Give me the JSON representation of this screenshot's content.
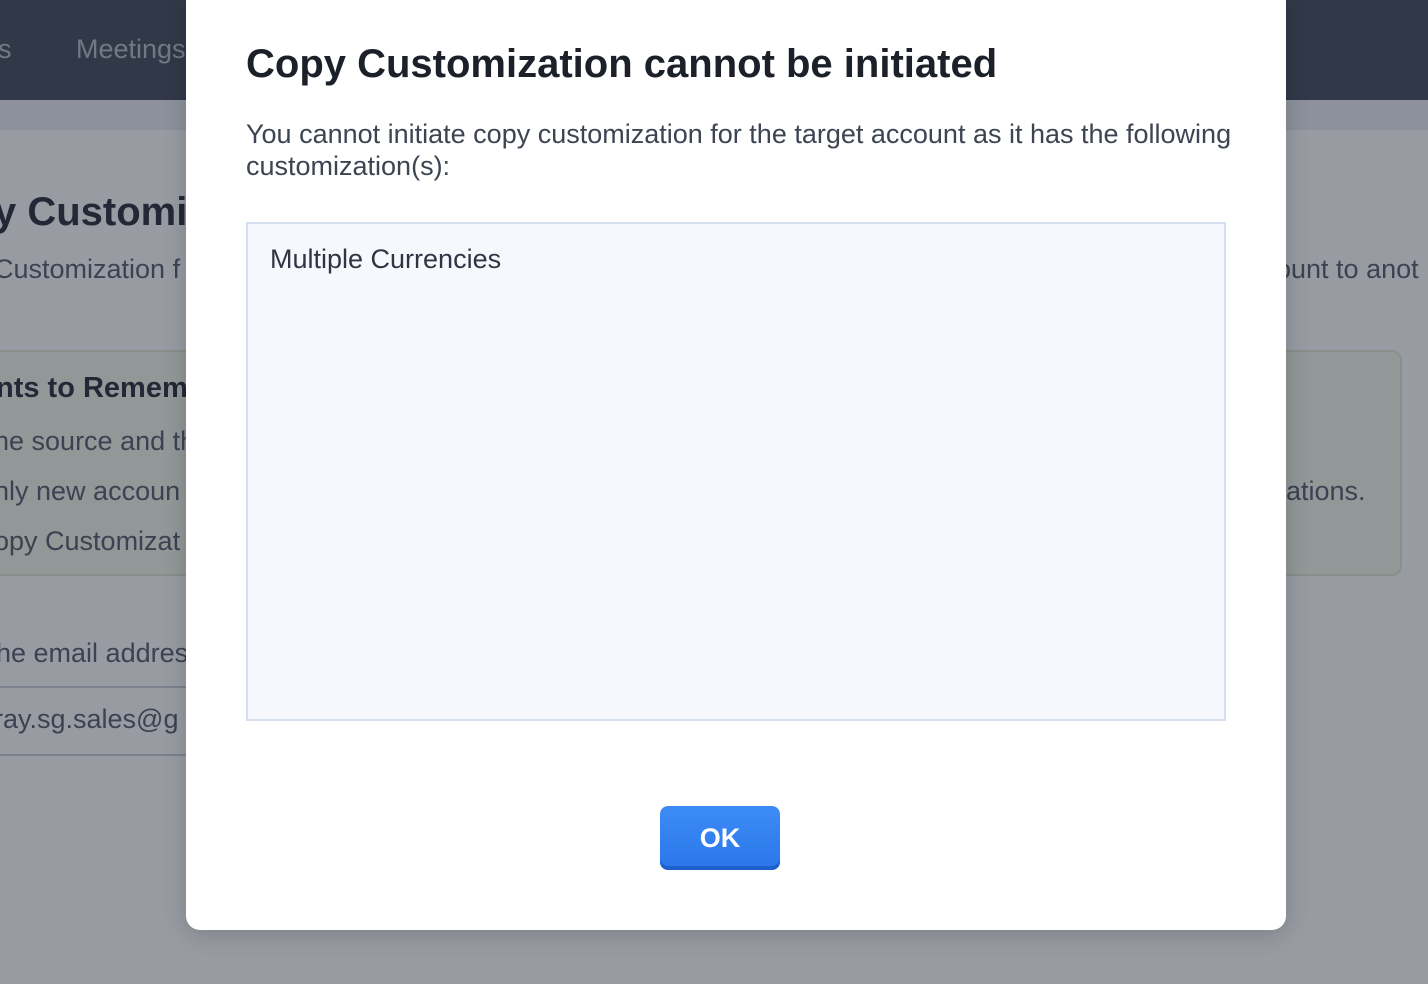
{
  "background": {
    "nav": {
      "partial_left": "s",
      "meetings": "Meetings"
    },
    "page": {
      "title": "y Customiz",
      "description_left": "Customization f",
      "description_right": "ount to anot"
    },
    "notes": {
      "title": "nts to Rememb",
      "items": [
        "he source and th",
        "nly new accoun",
        "opy Customizat"
      ],
      "item_2_right": "ations."
    },
    "email": {
      "label": "he email addres",
      "value": "ray.sg.sales@g"
    }
  },
  "modal": {
    "title": "Copy Customization cannot be initiated",
    "message": "You cannot initiate copy customization for the target account as it has the following customization(s):",
    "customizations": [
      "Multiple Currencies"
    ],
    "ok_label": "OK"
  },
  "colors": {
    "topbar": "#3a4253",
    "overlay": "rgba(40,45,60,0.48)",
    "primary_button": "#2a76ea",
    "list_background": "#f6f8fd"
  }
}
